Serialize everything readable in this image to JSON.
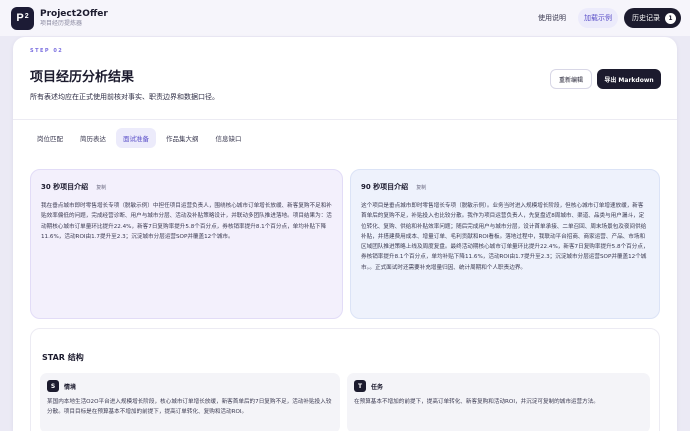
{
  "app": {
    "logo_text": "P",
    "logo_sup": "2",
    "name": "Project2Offer",
    "tagline": "项目经历提炼器"
  },
  "nav": {
    "help": "使用说明",
    "example": "加载示例",
    "history": "历史记录",
    "history_count": "1"
  },
  "header": {
    "step": "STEP 02",
    "title": "项目经历分析结果",
    "subtitle": "所有表述均应在正式使用前核对事实、职责边界和数据口径。",
    "reedit": "重新编辑",
    "export": "导出 Markdown"
  },
  "tabs": [
    {
      "label": "岗位匹配"
    },
    {
      "label": "简历表达"
    },
    {
      "label": "面试准备"
    },
    {
      "label": "作品集大纲"
    },
    {
      "label": "信息缺口"
    }
  ],
  "intro30": {
    "title": "30 秒项目介绍",
    "copy": "复制",
    "body": "我在垂点城市即时零售增长专项（脱敏示例）中担任项目运营负责人，围绕核心城市订单增长放缓、新客复购不足和补贴效率偏低的问题，完成经营诊断、用户与城市分层、活动及补贴策略设计，并联动多团队推进落地。项目结果为：活动期核心城市订单量环比提升22.4%，新客7日复购率提升5.8个百分点，券核销率提升8.1个百分点，单均补贴下降11.6%，活动ROI由1.7提升至2.3；沉淀城市分层运营SOP并覆盖12个城市。"
  },
  "intro90": {
    "title": "90 秒项目介绍",
    "copy": "复制",
    "body": "这个项目是垂点城市即时零售增长专项（脱敏示例）。业务当时进入规模增长阶段，但核心城市订单增速放缓，新客首单后的复购不足，补贴投入也比较分散。我作为项目运营负责人，先复盘近8周城市、渠道、品类与用户漏斗，定位转化、复购、供给和补贴效率问题；随后完成用户与城市分层，设计首单承接、二单召回、周末场景包及夜间供给补贴，并搭建费用成本、增量订单、毛利贡献和ROI看板。落地过程中，我联动平台招商、商家运营、产品、市场和区域团队推进策略上线及周度复盘。最终活动期核心城市订单量环比提升22.4%，新客7日复购率提升5.8个百分点，券核销率提升8.1个百分点，单均补贴下降11.6%，活动ROI由1.7提升至2.3；沉淀城市分层运营SOP并覆盖12个城市。。正式面试时还需要补充增量归因、统计周期和个人职责边界。"
  },
  "star": {
    "title": "STAR 结构",
    "situation": {
      "icon": "S",
      "label": "情境",
      "body": "某国内本地生活O2O平台进入规模增长阶段，核心城市订单增长放缓，新客首单后的7日复购不足，活动补贴投入较分散。项目目标是在预算基本不增加的前提下，提高订单转化、复购和活动ROI。"
    },
    "task": {
      "icon": "T",
      "label": "任务",
      "body": "在预算基本不增加的前提下，提高订单转化、新客复购和活动ROI，并沉淀可复制的城市运营方法。"
    }
  }
}
